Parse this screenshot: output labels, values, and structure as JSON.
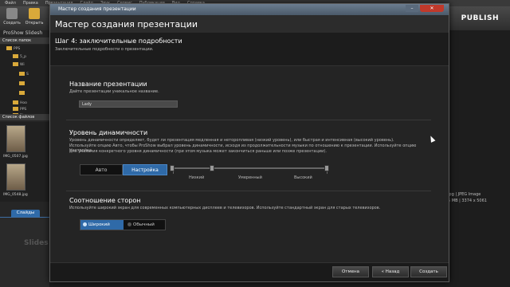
{
  "menubar": [
    "Файл",
    "Правка",
    "Презентация",
    "Слайд",
    "Звук",
    "Сервис",
    "Публикация",
    "Вид",
    "Справка"
  ],
  "toolbar": {
    "create": "Создать",
    "open": "Открыть",
    "publish": "PUBLISH"
  },
  "left": {
    "app_name": "ProShow Slidesh",
    "folders_header": "Список папок",
    "tree": [
      "PPS",
      "5_р",
      "Wi",
      "S",
      "Ноо",
      "PPS",
      "Ri",
      "Mi"
    ],
    "files_header": "Список файлов",
    "thumbs": [
      "IMG_0507.jpg",
      "IMG_0548.jpg"
    ],
    "slides_tab": "Слайды",
    "slides_placeholder": "Slides"
  },
  "right": {
    "line1": "jpg  |  JPEG Image",
    "line2": "5 MB  |  3374 x 5061"
  },
  "dialog": {
    "window_title": "Мастер создания презентации",
    "header": "Мастер создания презентации",
    "step_title": "Шаг 4: заключительные подробности",
    "step_sub": "Заключительные подробности о презентации.",
    "name_section": {
      "title": "Название презентации",
      "desc": "Дайте презентации уникальное название.",
      "value": "Lady"
    },
    "dynamics_section": {
      "title": "Уровень динамичности",
      "desc1": "Уровень динамичности определяет, будет ли презентация медленная и неторопливая (низкий уровень), или быстрая и интенсивная (высокий уровень).",
      "desc2": "Используйте опцию Авто, чтобы ProShow выбрал уровень динамичности, исходя из продолжительности музыки по отношению к презентации. Используйте опцию Настройка",
      "desc3": "для указания конкретного уровня динамичности (при этом музыка может закончиться раньше или позже презентации).",
      "auto": "Авто",
      "custom": "Настройка",
      "low": "Низкий",
      "medium": "Умеренный",
      "high": "Высокий",
      "level": 0.25
    },
    "aspect_section": {
      "title": "Соотношение сторон",
      "desc": "Используйте широкий экран для современных компьютерных дисплеев и телевизоров. Используйте стандартный экран для старых телевизоров.",
      "wide": "Широкий",
      "normal": "Обычный"
    },
    "buttons": {
      "cancel": "Отмена",
      "back": "« Назад",
      "create": "Создать"
    }
  },
  "colors": {
    "accent": "#2f6aa8",
    "title_bar": "#5b6c7e"
  }
}
